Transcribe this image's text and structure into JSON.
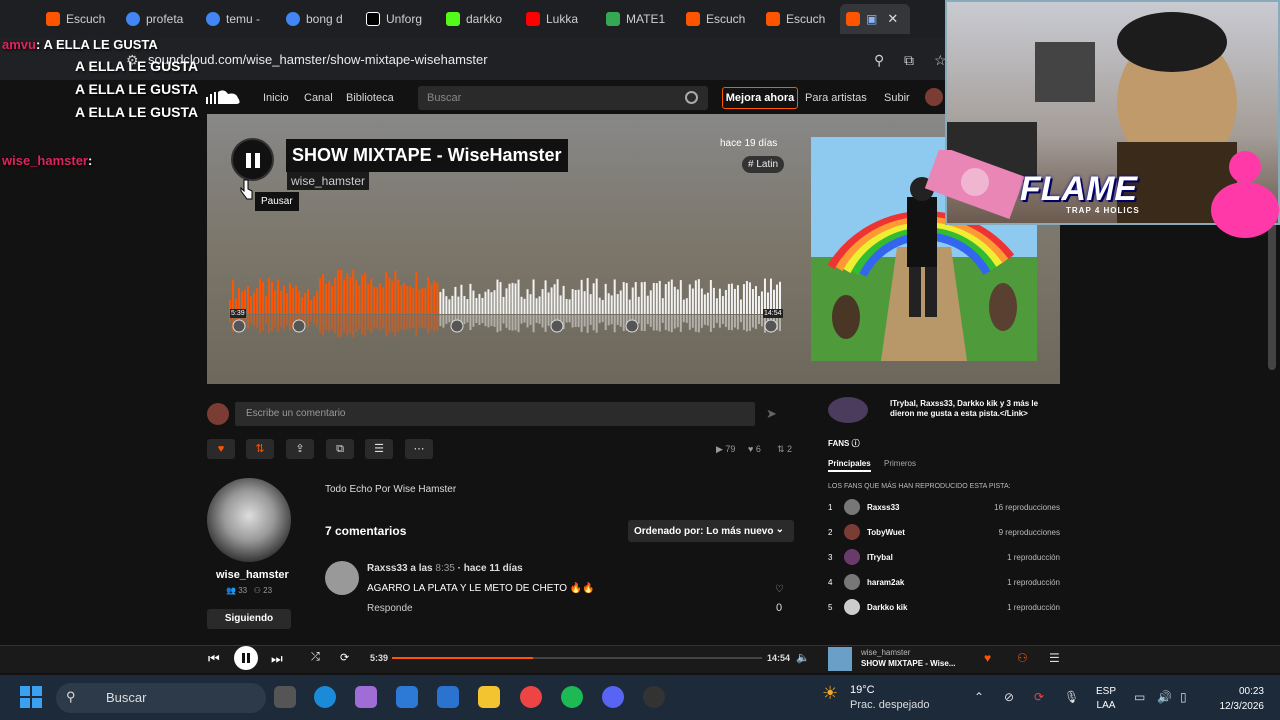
{
  "browser": {
    "tabs": [
      {
        "label": "Escuch",
        "color": "#ff5500"
      },
      {
        "label": "profeta",
        "color": "#4285f4"
      },
      {
        "label": "temu -",
        "color": "#4285f4"
      },
      {
        "label": "bong d",
        "color": "#4285f4"
      },
      {
        "label": "Unforg",
        "color": "#000000"
      },
      {
        "label": "darkko",
        "color": "#53fc18"
      },
      {
        "label": "Lukka",
        "color": "#ff0000"
      },
      {
        "label": "MATE1",
        "color": "#34a853"
      },
      {
        "label": "Escuch",
        "color": "#ff5500"
      },
      {
        "label": "Escuch",
        "color": "#ff5500"
      }
    ],
    "url": "soundcloud.com/wise_hamster/show-mixtape-wisehamster"
  },
  "soundcloud": {
    "nav": [
      "Inicio",
      "Canal",
      "Biblioteca"
    ],
    "search_placeholder": "Buscar",
    "upgrade_label": "Mejora ahora",
    "for_artists": "Para artistas",
    "upload": "Subir",
    "track": {
      "title": "SHOW MIXTAPE - WiseHamster",
      "artist": "wise_hamster",
      "posted": "hace 19 días",
      "genre": "# Latin",
      "pause_tooltip": "Pausar",
      "time_elapsed": "5:39",
      "time_total": "14:54",
      "progress": 0.38
    },
    "comment_placeholder": "Escribe un comentario",
    "stats": {
      "plays": "79",
      "likes": "6",
      "reposts": "2"
    },
    "profile": {
      "name": "wise_hamster",
      "followers": "33",
      "following": "23",
      "follow_label": "Siguiendo"
    },
    "description": "Todo Echo Por Wise Hamster",
    "comments_count": "7 comentarios",
    "sort_label": "Ordenado por: Lo más nuevo",
    "comment": {
      "user": "Raxss33",
      "at": "a las",
      "at_time": "8:35",
      "ago": "· hace 11 días",
      "text": "AGARRO LA PLATA Y LE METO DE CHETO 🔥🔥",
      "reply": "Responde",
      "likes": "0"
    },
    "likers_text": "ITrybal, Raxss33, Darkko kik y 3 más le dieron me gusta a esta pista.</Link>",
    "fans_label": "FANS",
    "fans_tabs": [
      "Principales",
      "Primeros"
    ],
    "fans_sub": "LOS FANS QUE MÁS HAN REPRODUCIDO ESTA PISTA:",
    "fans": [
      {
        "rank": "1",
        "name": "Raxss33",
        "plays": "16 reproducciones"
      },
      {
        "rank": "2",
        "name": "TobyWuet",
        "plays": "9 reproducciones"
      },
      {
        "rank": "3",
        "name": "ITrybal",
        "plays": "1 reproducción"
      },
      {
        "rank": "4",
        "name": "haram2ak",
        "plays": "1 reproducción"
      },
      {
        "rank": "5",
        "name": "Darkko kik",
        "plays": "1 reproducción"
      }
    ]
  },
  "player": {
    "elapsed": "5:39",
    "total": "14:54",
    "progress": 0.38,
    "now_artist": "wise_hamster",
    "now_title": "SHOW MIXTAPE - Wise..."
  },
  "taskbar": {
    "search": "Buscar",
    "temp": "19°C",
    "weather": "Prac. despejado",
    "lang1": "ESP",
    "lang2": "LAA",
    "time": "00:23",
    "date": "12/3/2026"
  },
  "stream": {
    "chat": [
      {
        "user": "amvu",
        "text": "A ELLA LE GUSTA"
      },
      {
        "user": "",
        "text": "A ELLA LE GUSTA"
      },
      {
        "user": "",
        "text": "A ELLA LE GUSTA"
      },
      {
        "user": "",
        "text": "A ELLA LE GUSTA"
      },
      {
        "user": "wise_hamster",
        "text": ""
      }
    ],
    "overlay_title": "FLAME",
    "overlay_sub": "TRAP 4 HOLICS"
  },
  "colors": {
    "accent": "#ff5500",
    "played": "#ff5500",
    "unplayed": "#f2f2f2"
  }
}
